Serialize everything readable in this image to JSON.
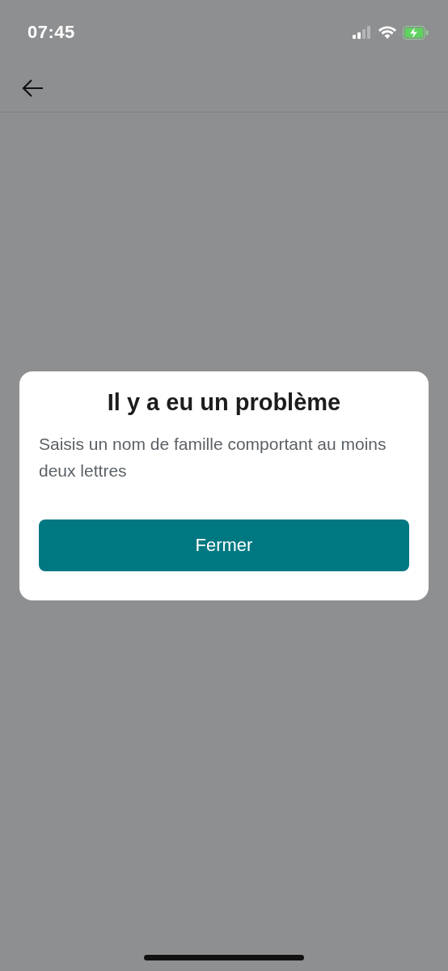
{
  "status_bar": {
    "time": "07:45"
  },
  "dialog": {
    "title": "Il y a eu un problème",
    "message": "Saisis un nom de famille comportant au moins deux lettres",
    "button": "Fermer"
  }
}
